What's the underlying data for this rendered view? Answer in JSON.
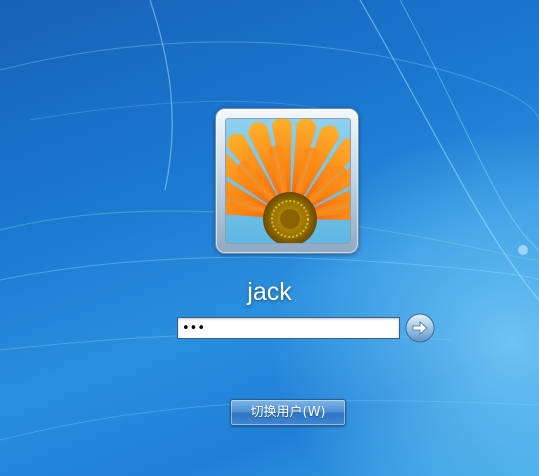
{
  "user": {
    "name": "jack",
    "avatar_icon": "orange-gerbera-flower-avatar"
  },
  "password": {
    "value": "•••",
    "placeholder": ""
  },
  "submit": {
    "icon": "arrow-right-icon"
  },
  "switch_user": {
    "label": "切换用户(W)"
  },
  "colors": {
    "background": "#1b78d0",
    "button_blue": "#3f87d2",
    "avatar_orange": "#f47a0c"
  }
}
